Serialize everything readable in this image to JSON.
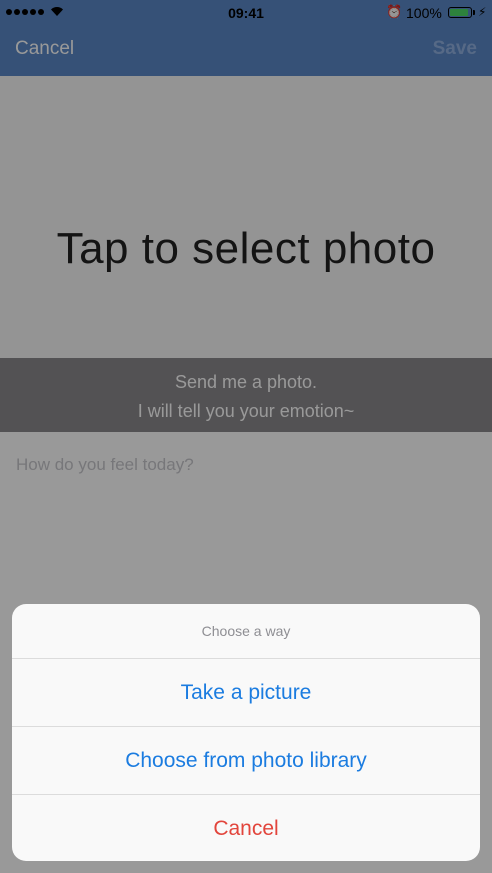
{
  "status_bar": {
    "time": "09:41",
    "battery_percent_text": "100%",
    "battery_level": 1.0,
    "icons": [
      "signal-dots-icon",
      "wifi-icon",
      "alarm-icon",
      "battery-icon",
      "charging-icon"
    ]
  },
  "nav": {
    "cancel_label": "Cancel",
    "save_label": "Save"
  },
  "photo": {
    "prompt": "Tap to select photo"
  },
  "banner": {
    "line1": "Send me a photo.",
    "line2": "I will tell you your emotion~"
  },
  "feel_input": {
    "placeholder": "How do you feel today?",
    "value": ""
  },
  "action_sheet": {
    "title": "Choose a way",
    "options": [
      {
        "label": "Take a picture"
      },
      {
        "label": "Choose from photo library"
      }
    ],
    "cancel_label": "Cancel"
  },
  "colors": {
    "nav_bar": "#5a87c6",
    "action_blue": "#1b7ce0",
    "cancel_red": "#e2453c"
  }
}
